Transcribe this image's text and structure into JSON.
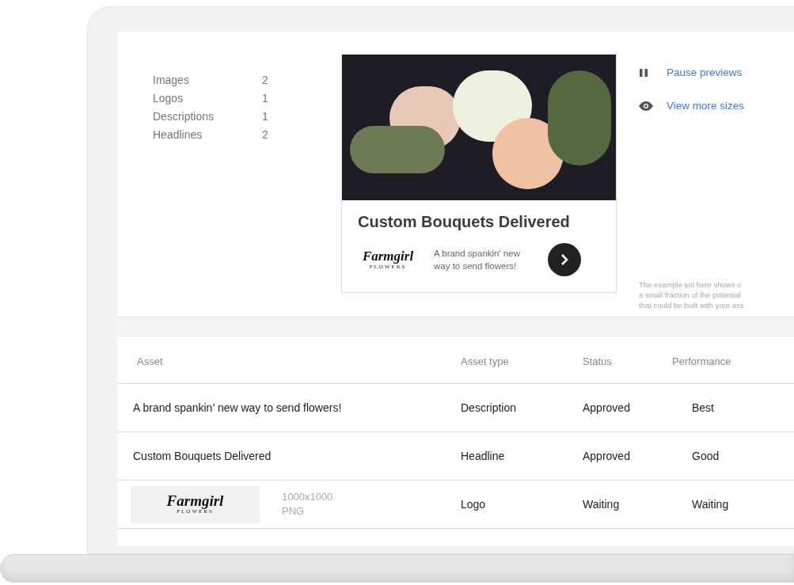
{
  "asset_counts": [
    {
      "label": "Images",
      "value": "2"
    },
    {
      "label": "Logos",
      "value": "1"
    },
    {
      "label": "Descriptions",
      "value": "1"
    },
    {
      "label": "Headlines",
      "value": "2"
    }
  ],
  "preview": {
    "headline": "Custom Bouquets Delivered",
    "logo": {
      "name": "Farmgirl",
      "subtitle": "FLOWERS"
    },
    "description": "A brand spankin' new way to send flowers!"
  },
  "actions": [
    {
      "kind": "pause",
      "label": "Pause previews"
    },
    {
      "kind": "eye",
      "label": "View more sizes"
    }
  ],
  "note_lines": [
    "The example set here shows o",
    "a small fraction of the potential",
    "that could be built with your ass"
  ],
  "table": {
    "columns": [
      "Asset",
      "Asset type",
      "Status",
      "Performance"
    ],
    "rows": [
      {
        "kind": "text",
        "asset": "A brand spankin’ new way to send flowers!",
        "asset_type": "Description",
        "status": "Approved",
        "performance": "Best"
      },
      {
        "kind": "text",
        "asset": "Custom Bouquets Delivered",
        "asset_type": "Headline",
        "status": "Approved",
        "performance": "Good"
      },
      {
        "kind": "logo",
        "logo": {
          "name": "Farmgirl",
          "subtitle": "FLOWERS"
        },
        "size": "1000x1000",
        "format": "PNG",
        "asset_type": "Logo",
        "status": "Waiting",
        "performance": "Waiting"
      }
    ]
  }
}
